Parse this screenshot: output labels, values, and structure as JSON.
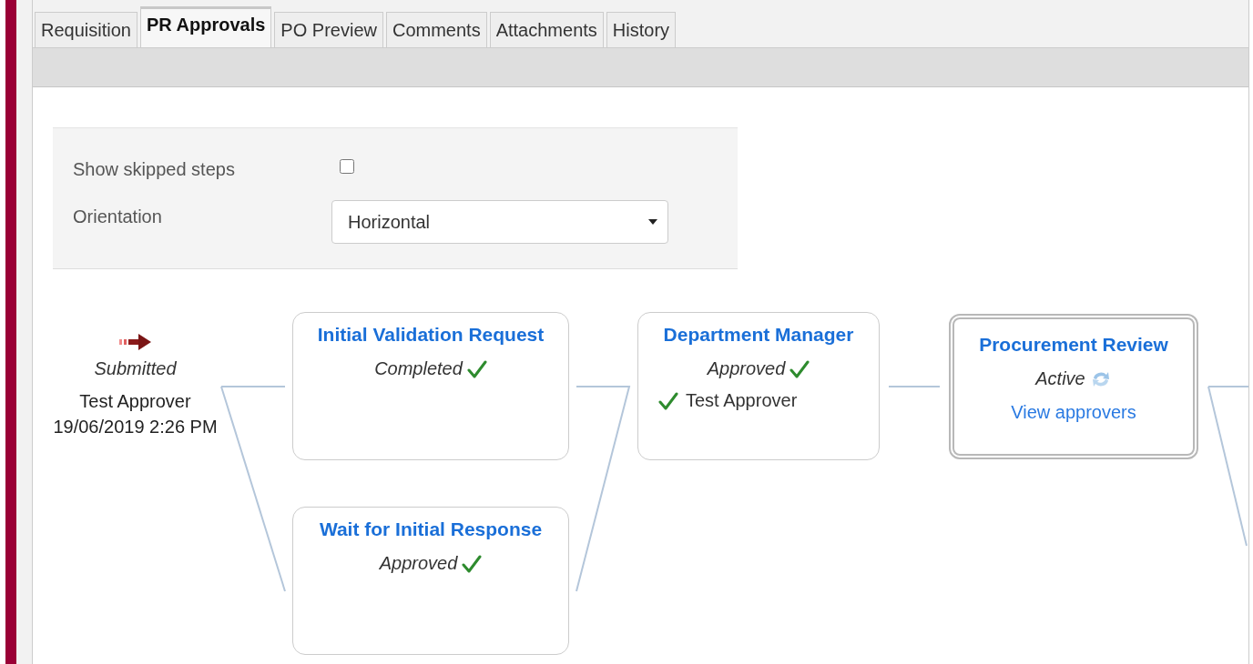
{
  "tabs": [
    {
      "label": "Requisition",
      "selected": false
    },
    {
      "label": "PR Approvals",
      "selected": true
    },
    {
      "label": "PO Preview",
      "selected": false
    },
    {
      "label": "Comments",
      "selected": false
    },
    {
      "label": "Attachments",
      "selected": false
    },
    {
      "label": "History",
      "selected": false
    }
  ],
  "options": {
    "show_skipped": {
      "label": "Show skipped steps",
      "checked": false
    },
    "orientation": {
      "label": "Orientation",
      "value": "Horizontal"
    }
  },
  "start": {
    "status": "Submitted",
    "person": "Test Approver",
    "date": "19/06/2019 2:26 PM"
  },
  "stages": [
    {
      "steps": [
        {
          "title": "Initial Validation Request",
          "status": "Completed",
          "kind": "done"
        },
        {
          "title": "Wait for Initial Response",
          "status": "Approved",
          "kind": "done"
        }
      ]
    },
    {
      "steps": [
        {
          "title": "Department Manager",
          "status": "Approved",
          "kind": "done",
          "approvers": [
            {
              "name": "Test Approver",
              "approved": true
            }
          ]
        }
      ]
    },
    {
      "steps": [
        {
          "title": "Procurement Review",
          "status": "Active",
          "kind": "active",
          "link": "View approvers"
        }
      ]
    }
  ]
}
